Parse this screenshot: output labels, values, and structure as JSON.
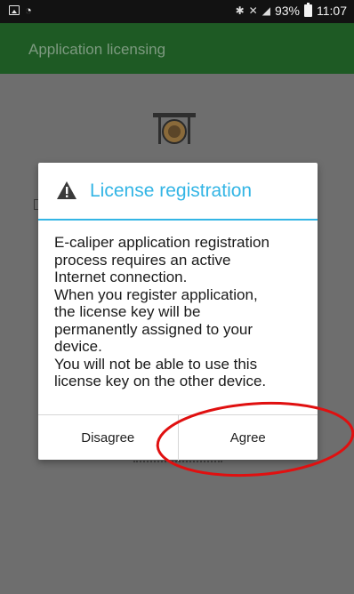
{
  "status_bar": {
    "battery": "93%",
    "time": "11:07",
    "icons": [
      "gallery-icon",
      "wifi-icon",
      "bluetooth-icon",
      "mute-icon",
      "signal-icon",
      "battery-icon"
    ]
  },
  "app_bar": {
    "title": "Application licensing"
  },
  "dialog": {
    "icon": "warning-icon",
    "title": "License registration",
    "body_lines": [
      "E-caliper application registration",
      "process requires an active",
      "Internet connection.",
      "When you register application,",
      "the license key will be",
      "permanently assigned to your",
      "device.",
      "You will not be able to use this",
      "license key on the other device."
    ],
    "disagree_label": "Disagree",
    "agree_label": "Agree"
  },
  "colors": {
    "app_bar": "#1e5a24",
    "accent": "#33b5e5",
    "annotation": "#e01010"
  }
}
